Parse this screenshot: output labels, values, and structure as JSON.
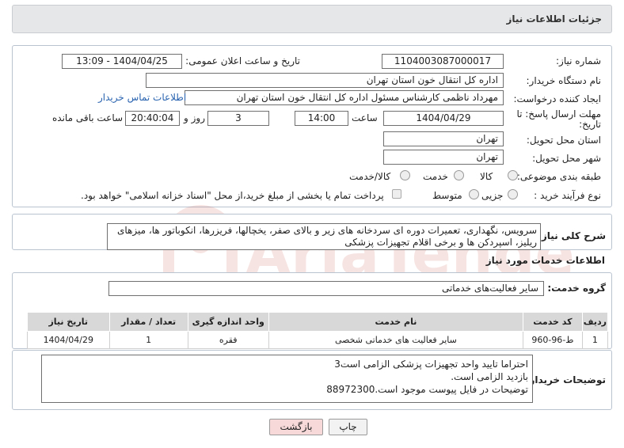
{
  "header": {
    "title": "جزئیات اطلاعات نیاز"
  },
  "form": {
    "need_number_label": "شماره نیاز:",
    "need_number": "1104003087000017",
    "announce_label": "تاریخ و ساعت اعلان عمومی:",
    "announce_value": "1404/04/25 - 13:09",
    "buyer_org_label": "نام دستگاه خریدار:",
    "buyer_org": "اداره کل انتقال خون استان تهران",
    "requester_label": "ایجاد کننده درخواست:",
    "requester": "مهرداد ناظمی کارشناس مسئول اداره کل انتقال خون استان تهران",
    "contact_link": "اطلاعات تماس خریدار",
    "deadline_label_1": "مهلت ارسال پاسخ: تا",
    "deadline_label_2": "تاریخ:",
    "deadline_date": "1404/04/29",
    "time_label": "ساعت",
    "deadline_time": "14:00",
    "days_value": "3",
    "days_label": "روز و",
    "remaining_time": "20:40:04",
    "remaining_label": "ساعت باقی مانده",
    "province_label": "استان محل تحویل:",
    "province": "تهران",
    "city_label": "شهر محل تحویل:",
    "city": "تهران",
    "category_label": "طبقه بندی موضوعی:",
    "category_options": [
      "کالا",
      "خدمت",
      "کالا/خدمت"
    ],
    "process_label": "نوع فرآیند خرید :",
    "process_options": [
      "جزیی",
      "متوسط"
    ],
    "payment_note": "پرداخت تمام یا بخشی از مبلغ خرید،از محل \"اسناد خزانه اسلامی\" خواهد بود."
  },
  "description": {
    "label": "شرح کلی نیاز:",
    "text": "سرویس، نگهداری، تعمیرات دوره ای سردخانه های زیر و بالای صفر، یخچالها، فریزرها، انکوباتور ها، میزهای ریلیز، اسپردکن ها و برخی اقلام تجهیزات پزشکی"
  },
  "services": {
    "section_title": "اطلاعات خدمات مورد نیاز",
    "group_label": "گروه خدمت:",
    "group_value": "سایر فعالیت‌های خدماتی",
    "columns": [
      "ردیف",
      "کد خدمت",
      "نام خدمت",
      "واحد اندازه گیری",
      "تعداد / مقدار",
      "تاریخ نیاز"
    ],
    "rows": [
      [
        "1",
        "ط-96-960",
        "سایر فعالیت های خدماتی شخصی",
        "فقره",
        "1",
        "1404/04/29"
      ]
    ]
  },
  "buyer_notes": {
    "label": "توضیحات خریدار:",
    "lines": [
      "احتراما تایید واحد تجهیزات پزشکی الزامی است3",
      "بازدید الزامی است.",
      "توضیحات در فایل پیوست موجود است.88972300"
    ]
  },
  "buttons": {
    "print": "چاپ",
    "back": "بازگشت"
  },
  "watermark": {
    "text": "AriaTender.neT"
  },
  "colors": {
    "link": "#2a64b0",
    "back_button": "#f7d9d9",
    "header_bg": "#e6e7e9",
    "table_header_bg": "#d8d8d8",
    "watermark": "#c0392b"
  }
}
